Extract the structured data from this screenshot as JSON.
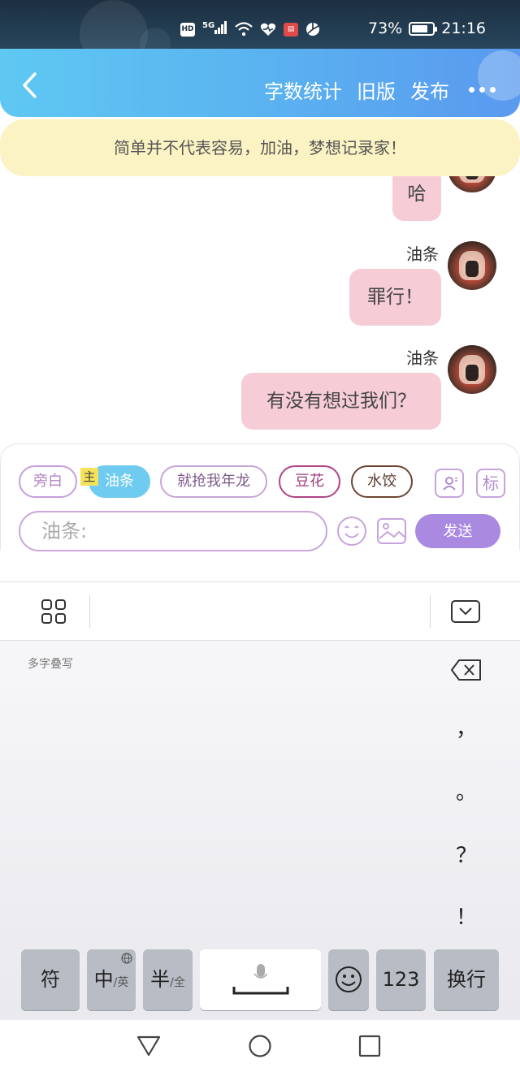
{
  "status_bar": {
    "icons": [
      "hd-icon",
      "5g-signal-icon",
      "wifi-icon",
      "health-icon",
      "book-app-icon",
      "photo-app-icon"
    ],
    "hd_label": "HD",
    "network_label": "5G",
    "battery_percent": "73%",
    "battery_level": 0.73,
    "time": "21:16"
  },
  "header": {
    "actions": {
      "word_count": "字数统计",
      "old_version": "旧版",
      "publish": "发布"
    }
  },
  "banner": {
    "text": "简单并不代表容易，加油，梦想记录家！"
  },
  "chat": {
    "messages": [
      {
        "sender": "",
        "text": "哈"
      },
      {
        "sender": "油条",
        "text": "罪行！"
      },
      {
        "sender": "油条",
        "text": "有没有想过我们？"
      }
    ]
  },
  "composer": {
    "roles": [
      {
        "label": "旁白"
      },
      {
        "label": "油条",
        "tag": "主"
      },
      {
        "label": "就抢我年龙"
      },
      {
        "label": "豆花"
      },
      {
        "label": "水饺"
      }
    ],
    "tag_button": "标",
    "input_value": "油条:",
    "send_label": "发送"
  },
  "keyboard": {
    "mode_label": "多字叠写",
    "punctuation": [
      "，",
      "。",
      "？",
      "！"
    ],
    "keys": {
      "symbols": "符",
      "chinese": "中",
      "chinese_alt": "/英",
      "half": "半",
      "half_alt": "/全",
      "numbers": "123",
      "enter": "换行"
    }
  },
  "colors": {
    "header_start": "#5fc8f2",
    "header_end": "#5a99ef",
    "banner_bg": "#fbf3c3",
    "bubble_bg": "#f6cdd7",
    "send_bg": "#a98ae0",
    "main_role_bg": "#6fcbef"
  }
}
